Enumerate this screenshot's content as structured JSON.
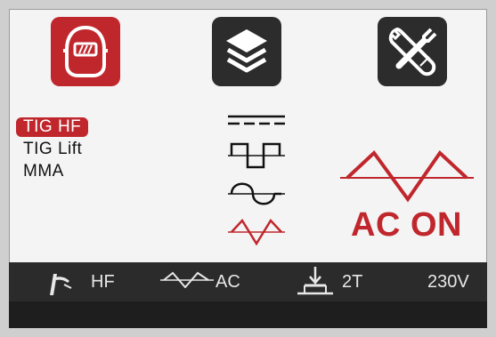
{
  "menu": {
    "icons": [
      {
        "icon": "welding-helmet-icon",
        "active": true
      },
      {
        "icon": "layers-icon",
        "active": false
      },
      {
        "icon": "tools-icon",
        "active": false
      }
    ]
  },
  "process_modes": [
    {
      "label": "TIG HF",
      "selected": true
    },
    {
      "label": "TIG Lift",
      "selected": false
    },
    {
      "label": "MMA",
      "selected": false
    }
  ],
  "waveforms": [
    {
      "icon": "dc-waveform-icon",
      "selected": false
    },
    {
      "icon": "square-waveform-icon",
      "selected": false
    },
    {
      "icon": "sine-waveform-icon",
      "selected": false
    },
    {
      "icon": "triangle-waveform-icon",
      "selected": true
    }
  ],
  "ac_status": {
    "label": "AC ON",
    "icon": "ac-triangle-wave-icon"
  },
  "status_bar": {
    "ignition": "HF",
    "current_type": "AC",
    "trigger_mode": "2T",
    "voltage": "230V"
  },
  "colors": {
    "accent": "#c0272d",
    "tile_dark": "#2c2c2c",
    "status_bar": "#2b2b2b"
  }
}
